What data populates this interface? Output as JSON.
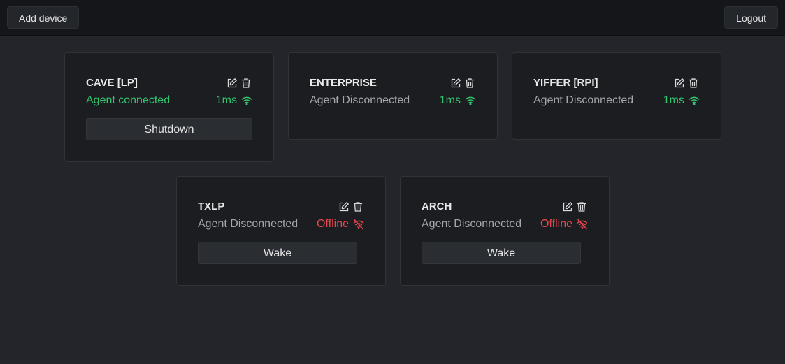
{
  "topbar": {
    "add_device_label": "Add device",
    "logout_label": "Logout"
  },
  "devices": [
    {
      "name": "CAVE [LP]",
      "agent": "Agent connected",
      "status": "1ms",
      "status_kind": "online",
      "button": "Shutdown"
    },
    {
      "name": "ENTERPRISE",
      "agent": "Agent Disconnected",
      "status": "1ms",
      "status_kind": "online",
      "button": ""
    },
    {
      "name": "YIFFER [RPI]",
      "agent": "Agent Disconnected",
      "status": "1ms",
      "status_kind": "online",
      "button": ""
    },
    {
      "name": "TXLP",
      "agent": "Agent Disconnected",
      "status": "Offline",
      "status_kind": "offline",
      "button": "Wake"
    },
    {
      "name": "ARCH",
      "agent": "Agent Disconnected",
      "status": "Offline",
      "status_kind": "offline",
      "button": "Wake"
    }
  ],
  "icons": {
    "edit": "edit-icon",
    "delete": "trash-icon",
    "online": "wifi-icon",
    "offline": "wifi-off-icon"
  },
  "colors": {
    "online": "#33c36e",
    "offline": "#e8474f"
  }
}
